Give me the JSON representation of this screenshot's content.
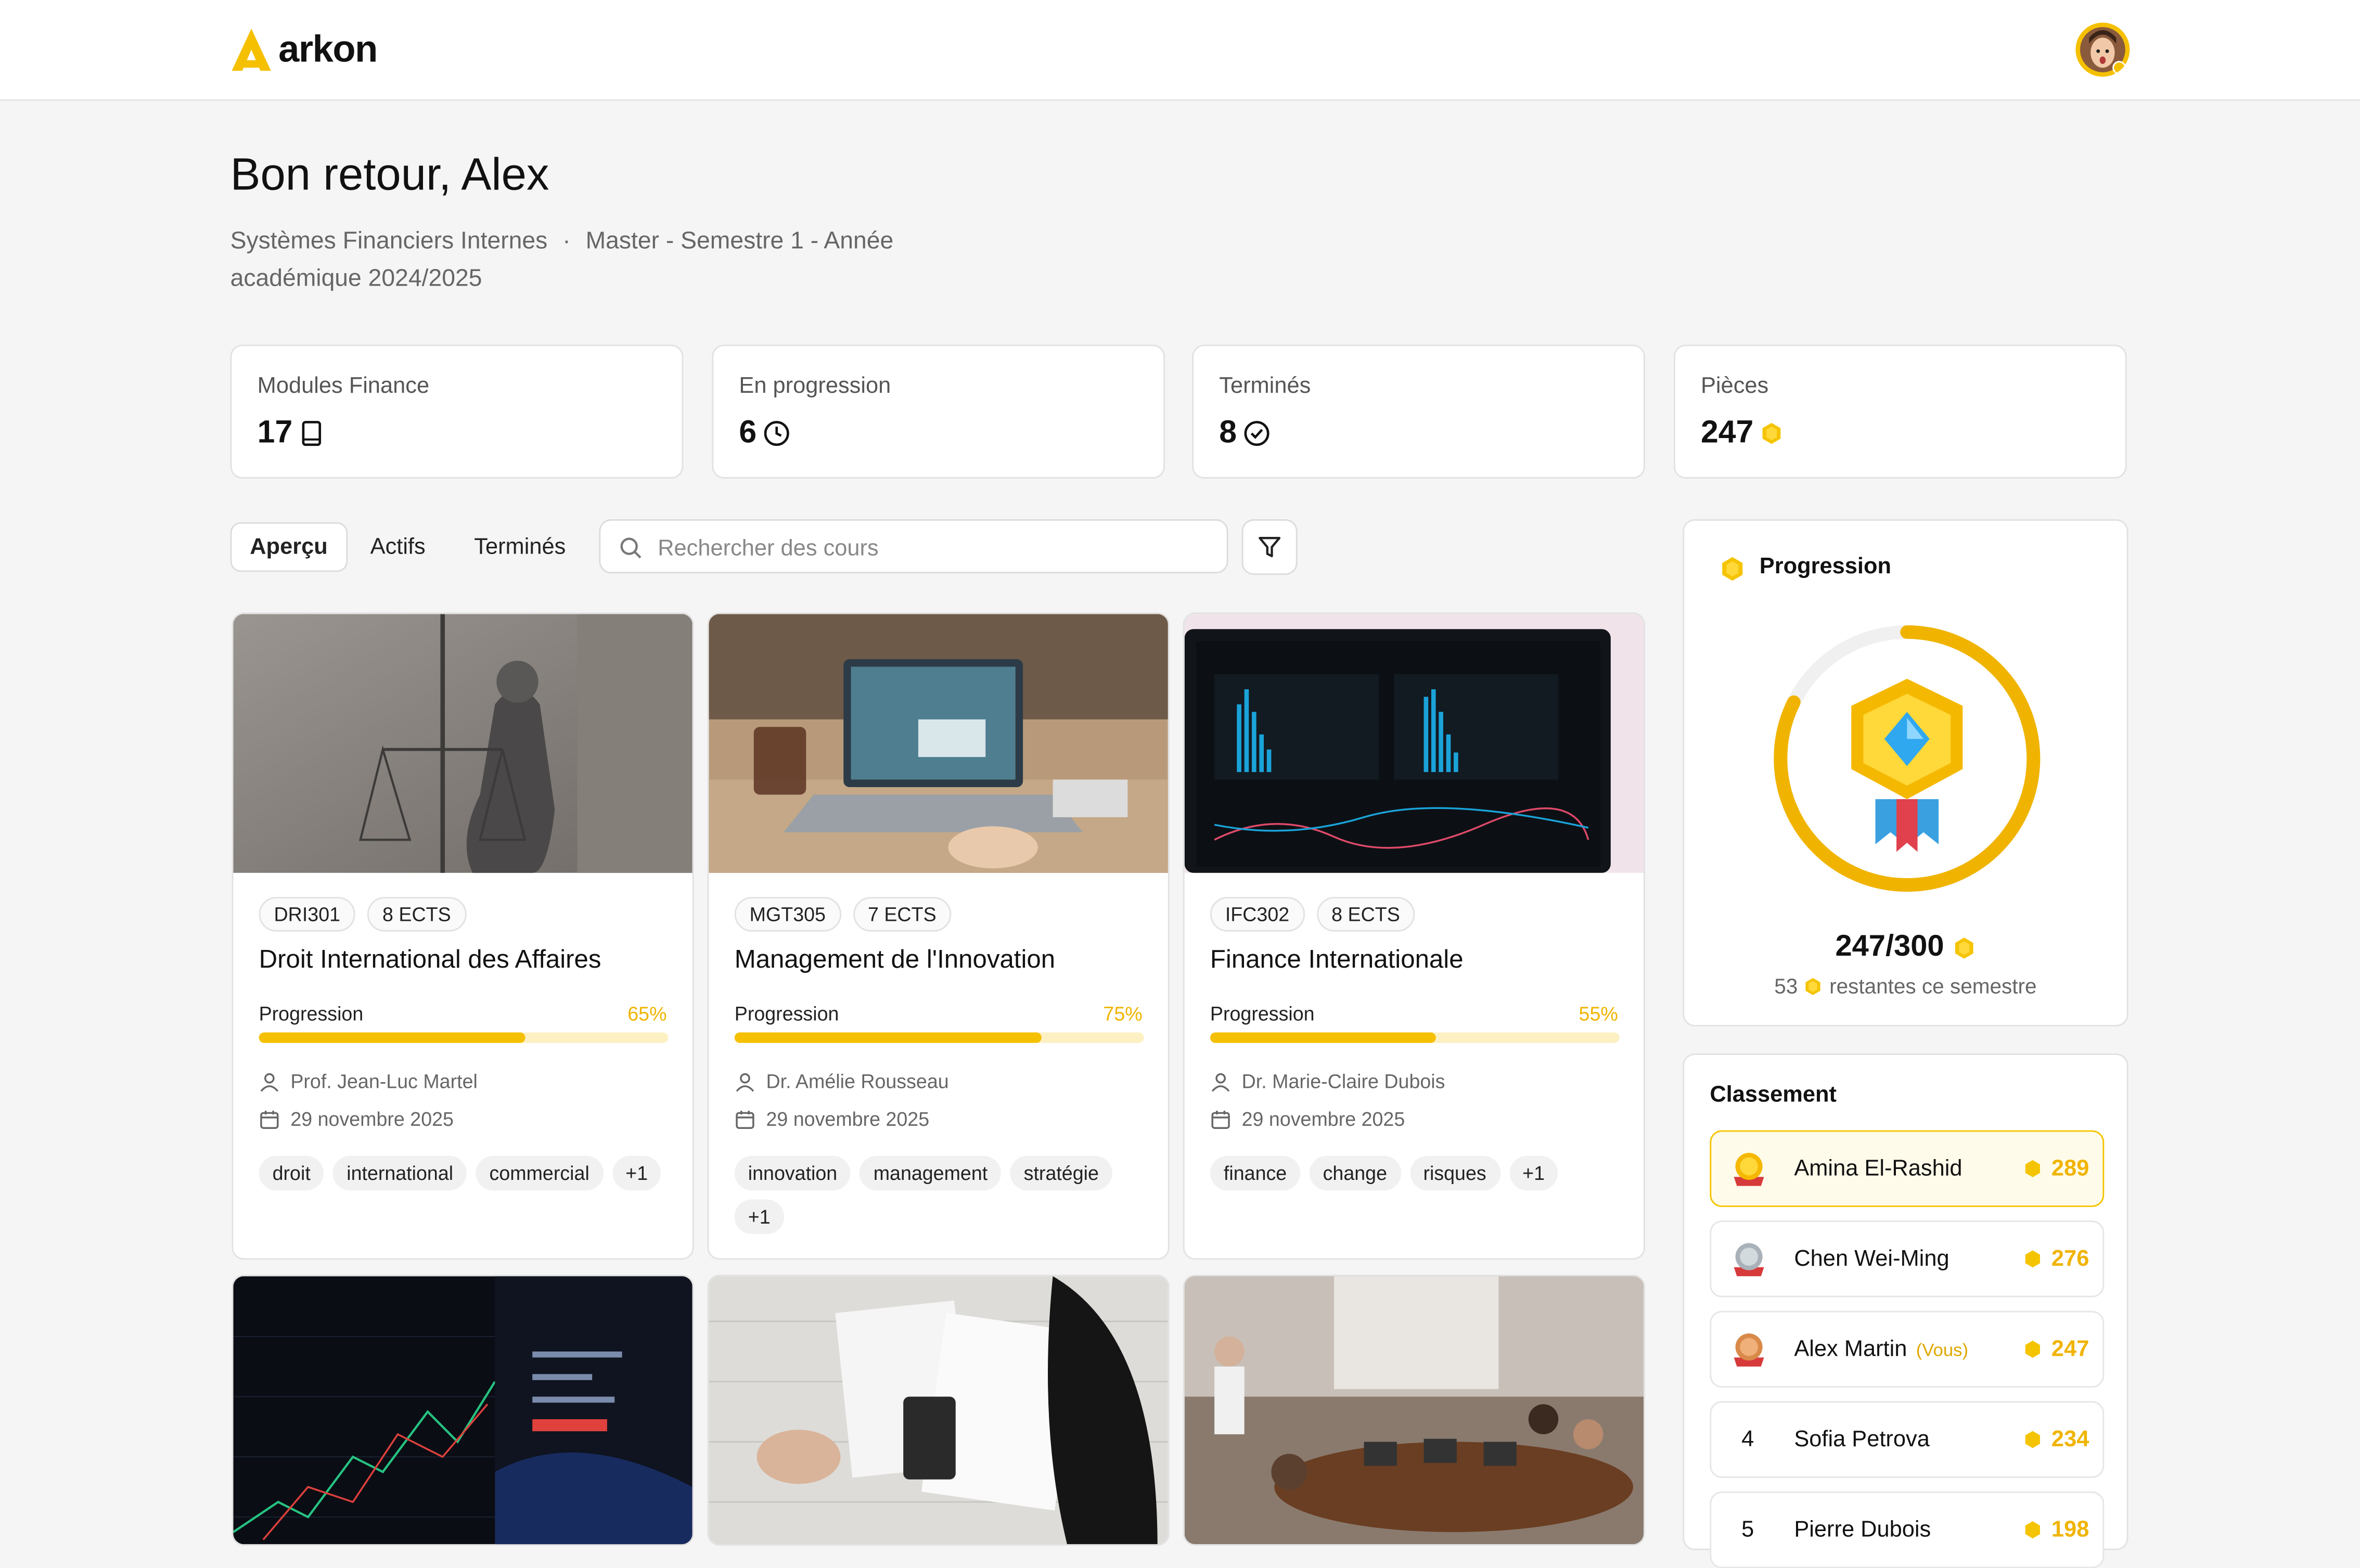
{
  "header": {
    "brand": "arkon",
    "accent_color": "#f5c000"
  },
  "greeting": {
    "title": "Bon retour, Alex",
    "program": "Systèmes Financiers Internes",
    "separator": "·",
    "semester": "Master - Semestre 1 - Année académique 2024/2025"
  },
  "stats": [
    {
      "label": "Modules Finance",
      "value": "17",
      "icon": "book-icon"
    },
    {
      "label": "En progression",
      "value": "6",
      "icon": "clock-icon"
    },
    {
      "label": "Terminés",
      "value": "8",
      "icon": "check-circle-icon"
    },
    {
      "label": "Pièces",
      "value": "247",
      "icon": "coin-icon"
    }
  ],
  "tabs": [
    {
      "label": "Aperçu",
      "active": true
    },
    {
      "label": "Actifs",
      "active": false
    },
    {
      "label": "Terminés",
      "active": false
    }
  ],
  "search": {
    "placeholder": "Rechercher des cours",
    "value": ""
  },
  "courses": [
    {
      "code": "DRI301",
      "ects": "8 ECTS",
      "title": "Droit International des Affaires",
      "progress_label": "Progression",
      "progress_pct": "65%",
      "progress": 65,
      "instructor": "Prof. Jean-Luc Martel",
      "date": "29 novembre 2025",
      "tags": [
        "droit",
        "international",
        "commercial",
        "+1"
      ]
    },
    {
      "code": "MGT305",
      "ects": "7 ECTS",
      "title": "Management de l'Innovation",
      "progress_label": "Progression",
      "progress_pct": "75%",
      "progress": 75,
      "instructor": "Dr. Amélie Rousseau",
      "date": "29 novembre 2025",
      "tags": [
        "innovation",
        "management",
        "stratégie",
        "+1"
      ]
    },
    {
      "code": "IFC302",
      "ects": "8 ECTS",
      "title": "Finance Internationale",
      "progress_label": "Progression",
      "progress_pct": "55%",
      "progress": 55,
      "instructor": "Dr. Marie-Claire Dubois",
      "date": "29 novembre 2025",
      "tags": [
        "finance",
        "change",
        "risques",
        "+1"
      ]
    }
  ],
  "progression": {
    "title": "Progression",
    "score": "247/300",
    "current": 247,
    "max": 300,
    "remaining_value": "53",
    "remaining_text": "restantes ce semestre"
  },
  "leaderboard": {
    "title": "Classement",
    "entries": [
      {
        "rank": "1",
        "name": "Amina El-Rashid",
        "points": "289",
        "you": ""
      },
      {
        "rank": "2",
        "name": "Chen Wei-Ming",
        "points": "276",
        "you": ""
      },
      {
        "rank": "3",
        "name": "Alex Martin",
        "points": "247",
        "you": "(Vous)"
      },
      {
        "rank": "4",
        "name": "Sofia Petrova",
        "points": "234",
        "you": ""
      },
      {
        "rank": "5",
        "name": "Pierre Dubois",
        "points": "198",
        "you": ""
      }
    ]
  }
}
